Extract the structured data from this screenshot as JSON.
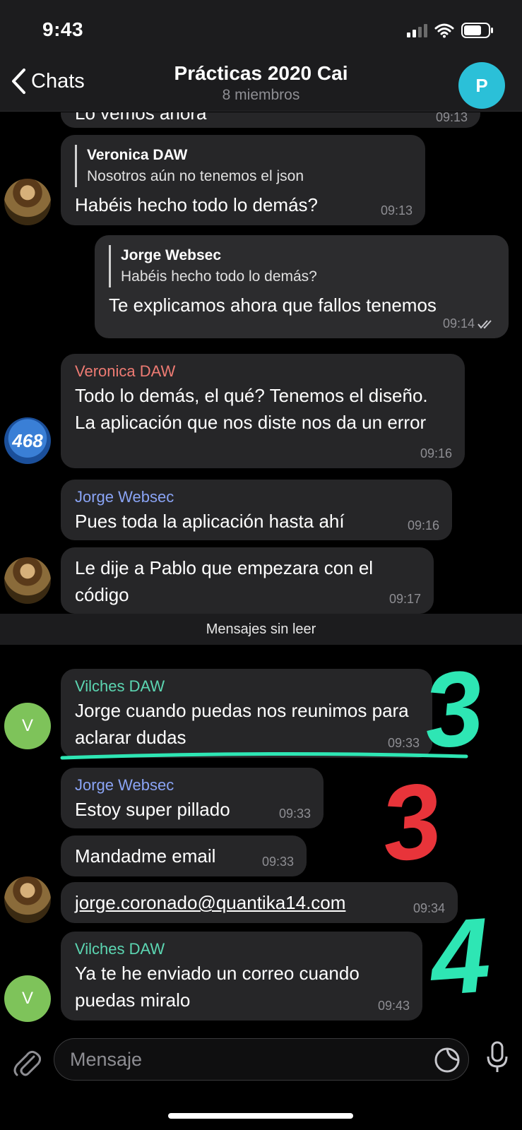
{
  "status": {
    "time": "9:43"
  },
  "header": {
    "back_label": "Chats",
    "title": "Prácticas 2020 Cai",
    "subtitle": "8 miembros",
    "avatar_letter": "P"
  },
  "messages": {
    "m0": {
      "text": "Lo vemos ahora",
      "time": "09:13"
    },
    "m1": {
      "reply_name": "Veronica DAW",
      "reply_text": "Nosotros aún no tenemos el json",
      "text": "Habéis hecho todo lo demás?",
      "time": "09:13"
    },
    "m2": {
      "reply_name": "Jorge Websec",
      "reply_text": "Habéis hecho todo lo demás?",
      "text": "Te explicamos ahora que fallos tenemos",
      "time": "09:14"
    },
    "m3": {
      "sender": "Veronica DAW",
      "text": "Todo lo demás, el qué? Tenemos el diseño. La aplicación que nos diste nos da un error",
      "time": "09:16"
    },
    "m4": {
      "sender": "Jorge Websec",
      "text": "Pues toda la aplicación hasta ahí",
      "time": "09:16"
    },
    "m5": {
      "text": "Le dije a Pablo que empezara con el código",
      "time": "09:17"
    },
    "unread": "Mensajes sin leer",
    "m6": {
      "sender": "Vilches DAW",
      "text": "Jorge cuando puedas nos reunimos para aclarar dudas",
      "time": "09:33"
    },
    "m7": {
      "sender": "Jorge Websec",
      "text": "Estoy super pillado",
      "time": "09:33"
    },
    "m8": {
      "text": "Mandadme email",
      "time": "09:33"
    },
    "m9": {
      "text": "jorge.coronado@quantika14.com",
      "time": "09:34"
    },
    "m10": {
      "sender": "Vilches DAW",
      "text": "Ya te he enviado un correo cuando puedas miralo",
      "time": "09:43"
    }
  },
  "avatars": {
    "badge_text": "468",
    "vilches_letter": "V"
  },
  "annotations": {
    "a1": {
      "text": "3",
      "color": "#2ee6b4"
    },
    "a2": {
      "text": "3",
      "color": "#e8343a"
    },
    "a3": {
      "text": "4",
      "color": "#2ee6b4"
    }
  },
  "input": {
    "placeholder": "Mensaje"
  },
  "colors": {
    "veronica": "#ee7b73",
    "jorge": "#8aa4f5",
    "vilches": "#5cd6b2",
    "group_avatar": "#2bc0d8"
  }
}
